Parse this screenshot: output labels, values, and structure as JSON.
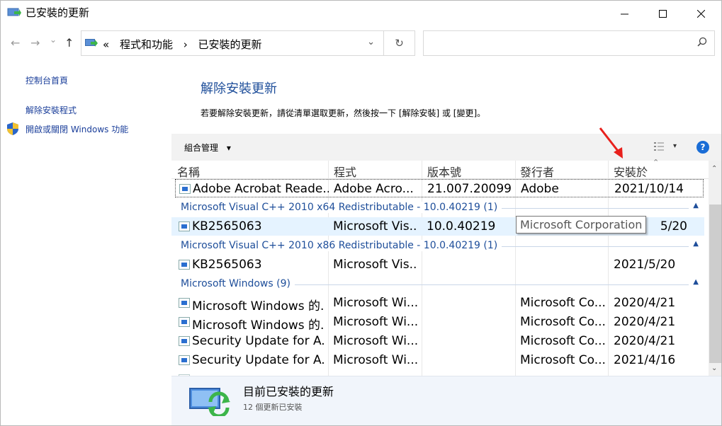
{
  "window": {
    "title": "已安裝的更新"
  },
  "nav": {
    "back": "←",
    "forward": "→",
    "recent": "⌄",
    "up": "↑"
  },
  "address": {
    "prefix": "«",
    "crumb1": "程式和功能",
    "sep": "›",
    "crumb2": "已安裝的更新",
    "dropdown": "⌄",
    "refresh": "↻"
  },
  "search": {
    "placeholder": ""
  },
  "sidebar": {
    "items": [
      {
        "label": "控制台首頁"
      },
      {
        "label": "解除安裝程式"
      },
      {
        "label": "開啟或關閉 Windows 功能"
      }
    ]
  },
  "main": {
    "title": "解除安裝更新",
    "description": "若要解除安裝更新，請從清單選取更新，然後按一下 [解除安裝] 或 [變更]。"
  },
  "toolbar": {
    "organize": "組合管理",
    "organize_drop": "▾",
    "view_drop": "▾",
    "help": "?"
  },
  "columns": [
    "名稱",
    "程式",
    "版本號",
    "發行者",
    "安裝於"
  ],
  "rows": [
    {
      "name": "Adobe Acrobat Reade...",
      "program": "Adobe Acro...",
      "version": "21.007.20099",
      "publisher": "Adobe",
      "date": "2021/10/14"
    },
    {
      "name": "KB2565063",
      "program": "Microsoft Vis...",
      "version": "10.0.40219",
      "publisher": "",
      "date": "5/20"
    },
    {
      "name": "KB2565063",
      "program": "Microsoft Vis...",
      "version": "",
      "publisher": "",
      "date": "2021/5/20"
    },
    {
      "name": "Microsoft Windows 的...",
      "program": "Microsoft Wi...",
      "version": "",
      "publisher": "Microsoft Co...",
      "date": "2020/4/21"
    },
    {
      "name": "Microsoft Windows 的...",
      "program": "Microsoft Wi...",
      "version": "",
      "publisher": "Microsoft Co...",
      "date": "2020/4/21"
    },
    {
      "name": "Security Update for A...",
      "program": "Microsoft Wi...",
      "version": "",
      "publisher": "Microsoft Co...",
      "date": "2020/4/21"
    },
    {
      "name": "Security Update for A...",
      "program": "Microsoft Wi...",
      "version": "",
      "publisher": "Microsoft Co...",
      "date": "2021/4/16"
    }
  ],
  "groups": [
    {
      "label": "Microsoft Visual C++ 2010  x64 Redistributable - 10.0.40219 (1)"
    },
    {
      "label": "Microsoft Visual C++ 2010  x86 Redistributable - 10.0.40219 (1)"
    },
    {
      "label": "Microsoft Windows (9)"
    }
  ],
  "tooltip": "Microsoft Corporation",
  "details": {
    "title": "目前已安裝的更新",
    "count": "12 個更新已安裝"
  },
  "colors": {
    "accent": "#1e4e9a",
    "link": "#1a3e9a",
    "selection": "#e5f3ff",
    "annotation_arrow": "#e8201c"
  }
}
